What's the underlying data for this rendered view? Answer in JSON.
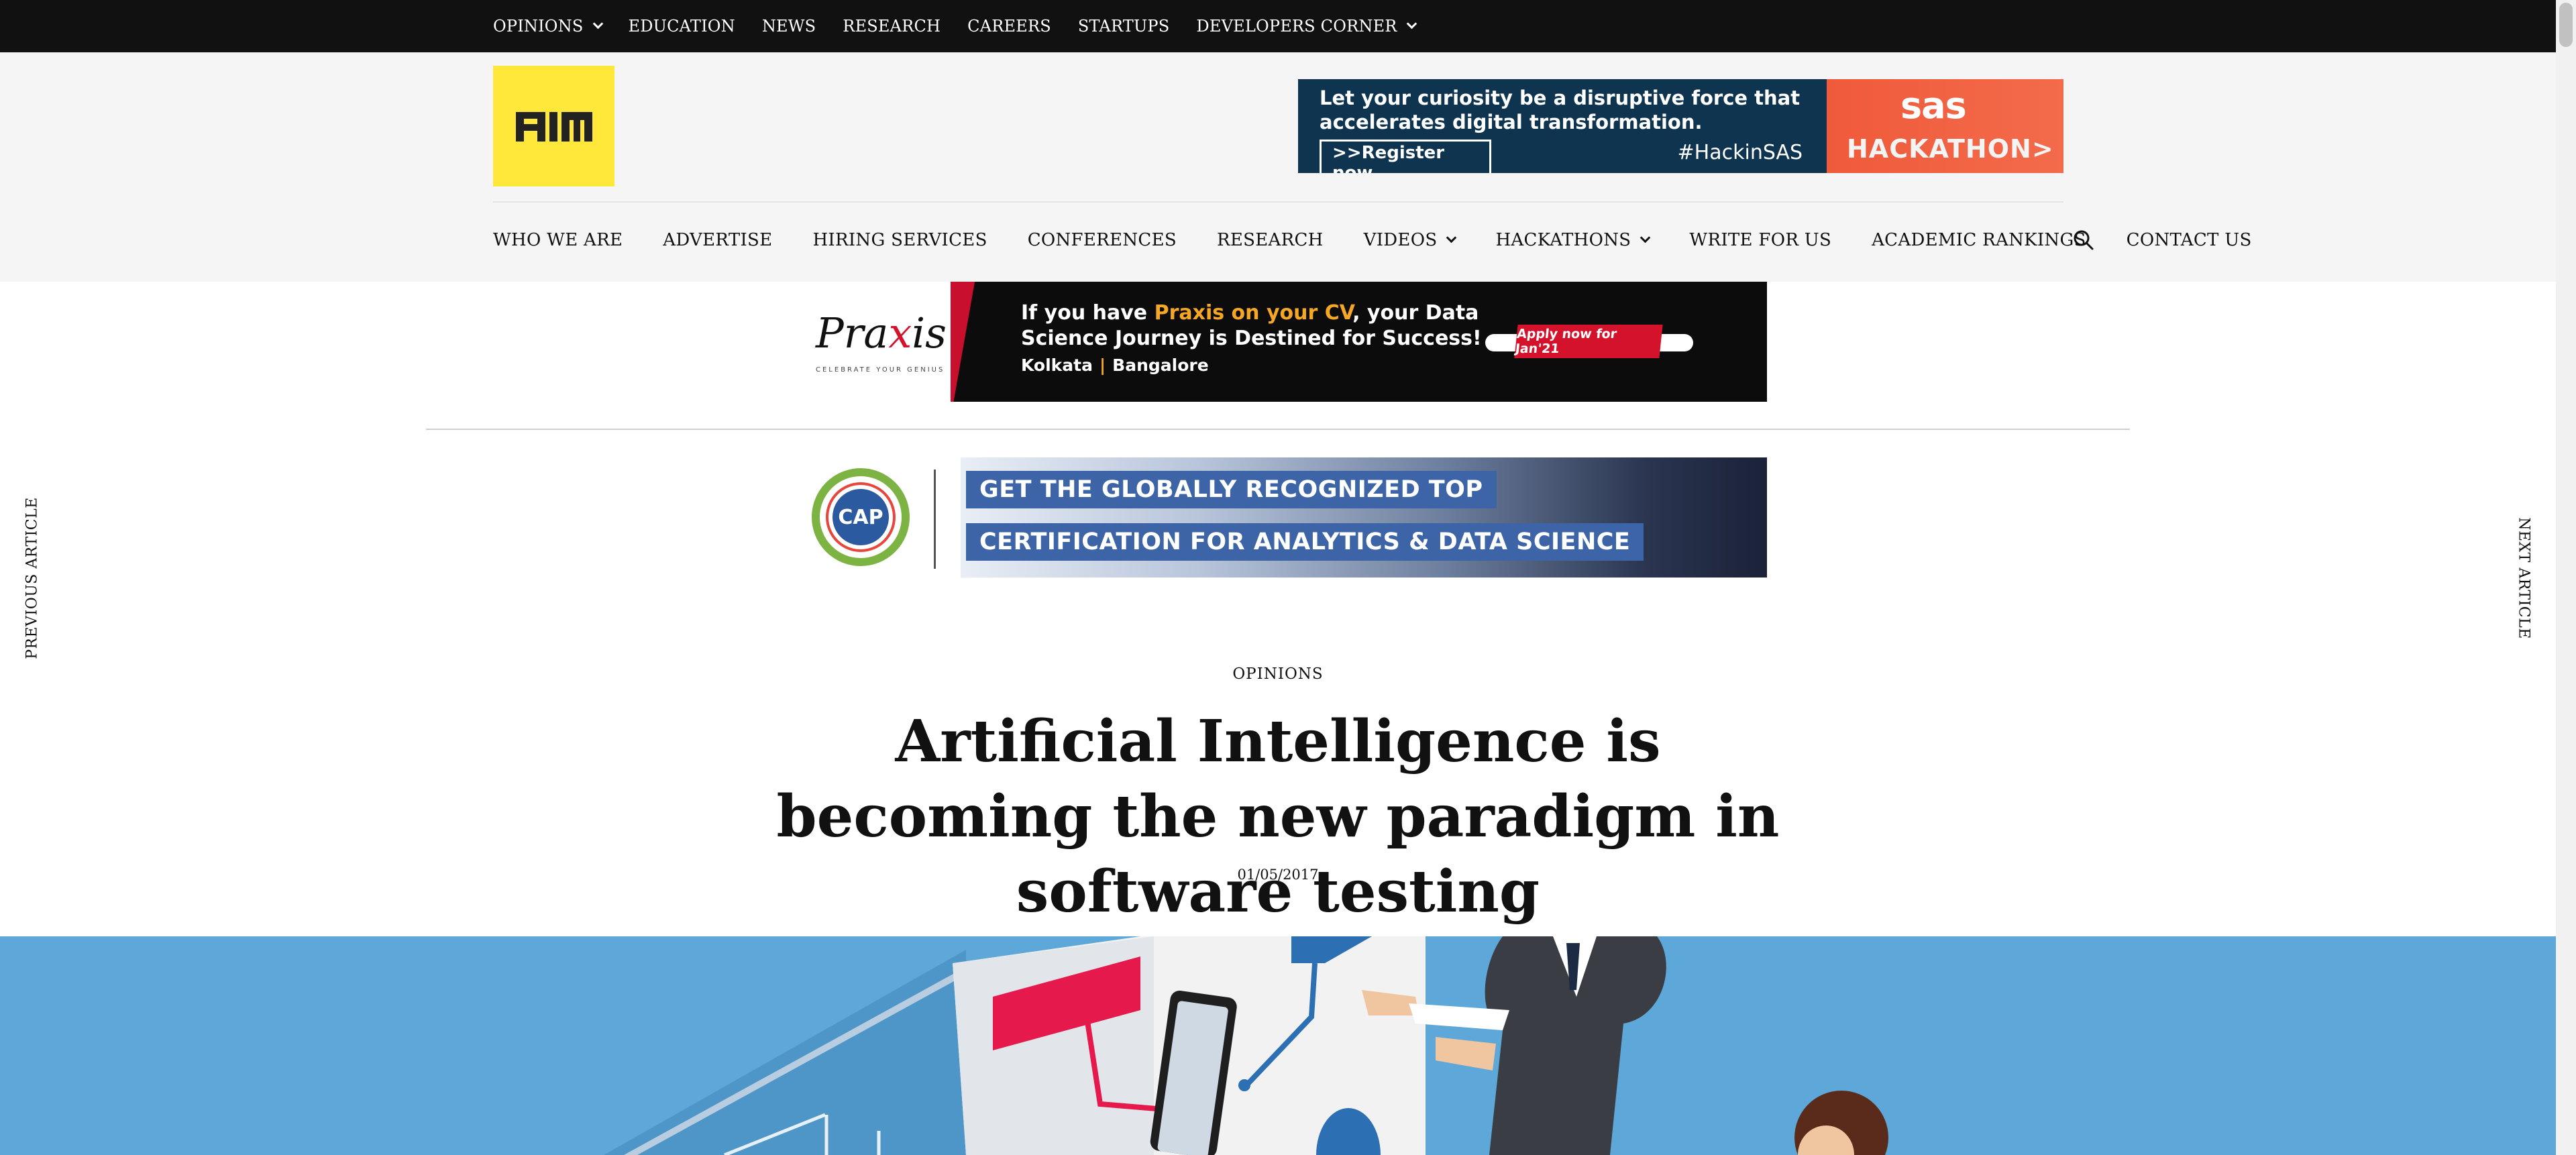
{
  "topnav": {
    "items": [
      "OPINIONS",
      "EDUCATION",
      "NEWS",
      "RESEARCH",
      "CAREERS",
      "STARTUPS",
      "DEVELOPERS CORNER"
    ]
  },
  "header": {
    "logo_text": "AIM",
    "sas_ad": {
      "headline": "Let your curiosity be a disruptive force that accelerates digital transformation.",
      "button": ">>Register now",
      "hashtag": "#HackinSAS",
      "brand": "sas",
      "event": "HACKATHON>"
    },
    "mainnav": {
      "items": [
        "WHO WE ARE",
        "ADVERTISE",
        "HIRING SERVICES",
        "CONFERENCES",
        "RESEARCH",
        "VIDEOS",
        "HACKATHONS",
        "WRITE FOR US",
        "ACADEMIC RANKINGS",
        "CONTACT US"
      ]
    }
  },
  "praxis_ad": {
    "logo": "Praxis",
    "logo_sub": "CELEBRATE YOUR GENIUS",
    "line1_pre": "If you have ",
    "line1_highlight": "Praxis on your CV",
    "line1_post": ", your Data",
    "line2": "Science Journey is Destined for Success!",
    "city1": "Kolkata",
    "separator": "|",
    "city2": "Bangalore",
    "cta": "Apply now for Jan'21"
  },
  "cap_ad": {
    "badge": "CAP",
    "line1": "GET THE GLOBALLY RECOGNIZED TOP",
    "line2": "CERTIFICATION FOR ANALYTICS & DATA SCIENCE"
  },
  "side": {
    "prev": "PREVIOUS ARTICLE",
    "next": "NEXT ARTICLE"
  },
  "article": {
    "category": "OPINIONS",
    "title": "Artificial Intelligence is becoming the new paradigm in software testing",
    "date": "01/05/2017"
  },
  "colors": {
    "topbar": "#111111",
    "header_bg": "#f5f5f5",
    "logo_yellow": "#ffe83a",
    "hero_blue": "#5ea8d9"
  }
}
